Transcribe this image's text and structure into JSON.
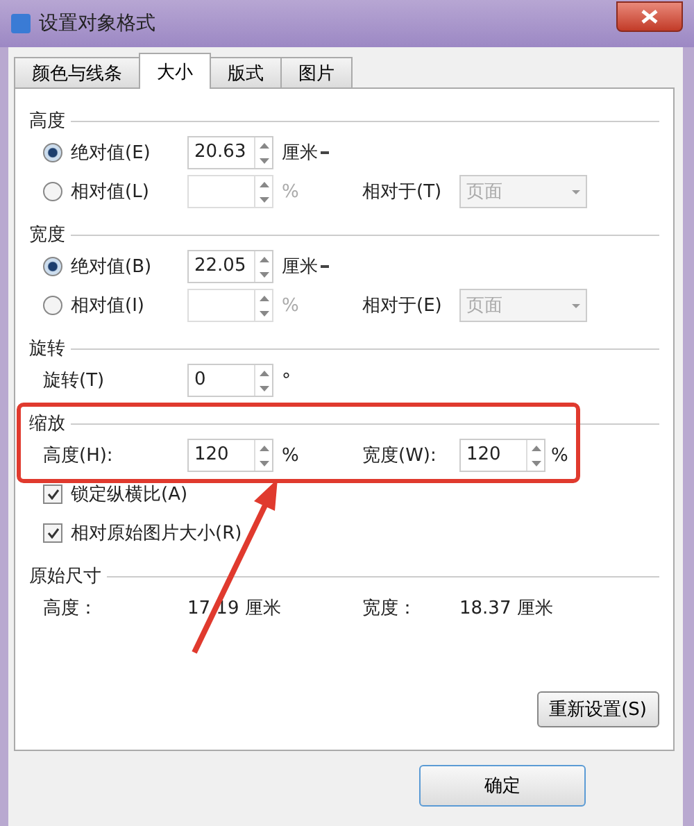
{
  "window": {
    "title": "设置对象格式"
  },
  "tabs": [
    {
      "label": "颜色与线条",
      "selected": false
    },
    {
      "label": "大小",
      "selected": true
    },
    {
      "label": "版式",
      "selected": false
    },
    {
      "label": "图片",
      "selected": false
    }
  ],
  "sections": [
    {
      "kind": "size",
      "title": "高度",
      "rows": [
        {
          "kind": "absolute",
          "selected": true,
          "label": "绝对值(E)",
          "value": "20.63",
          "unit": "厘米"
        },
        {
          "kind": "relative",
          "selected": false,
          "label": "相对值(L)",
          "unit": "%",
          "relative_label": "相对于(T)",
          "relative_value": "页面",
          "disabled": true
        }
      ]
    },
    {
      "kind": "size",
      "title": "宽度",
      "rows": [
        {
          "kind": "absolute",
          "selected": true,
          "label": "绝对值(B)",
          "value": "22.05",
          "unit": "厘米"
        },
        {
          "kind": "relative",
          "selected": false,
          "label": "相对值(I)",
          "unit": "%",
          "relative_label": "相对于(E)",
          "relative_value": "页面",
          "disabled": true
        }
      ]
    },
    {
      "kind": "rotate",
      "title": "旋转",
      "label": "旋转(T)",
      "value": "0",
      "unit": "°"
    },
    {
      "kind": "scale",
      "title": "缩放",
      "height_label": "高度(H):",
      "height_value": "120",
      "height_unit": "%",
      "width_label": "宽度(W):",
      "width_value": "120",
      "width_unit": "%",
      "checks": [
        {
          "label": "锁定纵横比(A)",
          "checked": true
        },
        {
          "label": "相对原始图片大小(R)",
          "checked": true
        }
      ]
    },
    {
      "kind": "original",
      "title": "原始尺寸",
      "height_label": "高度：",
      "height_value": "17.19 厘米",
      "width_label": "宽度：",
      "width_value": "18.37 厘米"
    }
  ],
  "reset_button": "重新设置(S)",
  "ok_button": "确定"
}
